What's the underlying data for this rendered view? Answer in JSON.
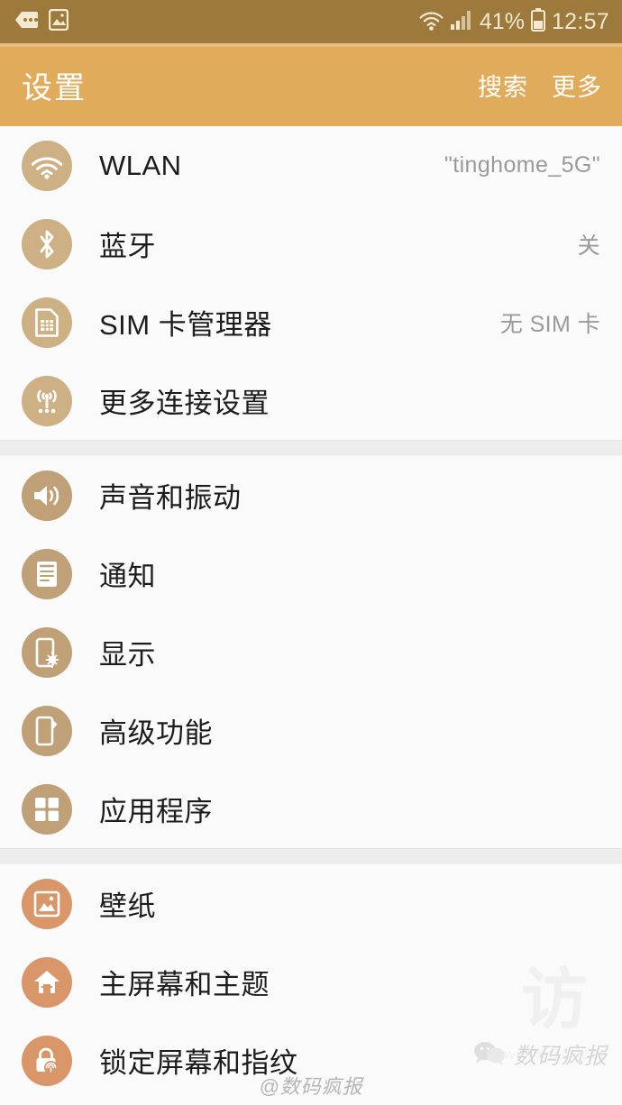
{
  "status_bar": {
    "background": "#9d7a3c",
    "foreground": "#f3e8d2",
    "notification_icons": [
      "message-bubble-icon",
      "gallery-image-icon"
    ],
    "wifi_icon": "wifi-icon",
    "signal_icon": "cellular-signal-icon",
    "battery_percent": "41%",
    "battery_icon": "battery-icon",
    "time": "12:57"
  },
  "app_bar": {
    "background": "#e0ab5b",
    "title": "设置",
    "actions": [
      {
        "label": "搜索",
        "name": "search"
      },
      {
        "label": "更多",
        "name": "more"
      }
    ]
  },
  "groups": [
    {
      "icon_color": "#cdb083",
      "rows": [
        {
          "icon": "wifi-icon",
          "label": "WLAN",
          "value": "\"tinghome_5G\""
        },
        {
          "icon": "bluetooth-icon",
          "label": "蓝牙",
          "value": "关"
        },
        {
          "icon": "sim-card-icon",
          "label": "SIM 卡管理器",
          "value": "无 SIM 卡"
        },
        {
          "icon": "broadcast-antenna-icon",
          "label": "更多连接设置",
          "value": ""
        }
      ]
    },
    {
      "icon_color": "#bfa077",
      "rows": [
        {
          "icon": "speaker-volume-icon",
          "label": "声音和振动",
          "value": ""
        },
        {
          "icon": "notification-list-icon",
          "label": "通知",
          "value": ""
        },
        {
          "icon": "display-brightness-icon",
          "label": "显示",
          "value": ""
        },
        {
          "icon": "advanced-features-icon",
          "label": "高级功能",
          "value": ""
        },
        {
          "icon": "apps-grid-icon",
          "label": "应用程序",
          "value": ""
        }
      ]
    },
    {
      "icon_color": "#d99668",
      "rows": [
        {
          "icon": "wallpaper-image-icon",
          "label": "壁纸",
          "value": ""
        },
        {
          "icon": "home-screen-themes-icon",
          "label": "主屏幕和主题",
          "value": ""
        },
        {
          "icon": "lock-fingerprint-icon",
          "label": "锁定屏幕和指纹",
          "value": ""
        }
      ]
    }
  ],
  "watermarks": {
    "bottom": "@数码疯报",
    "side": "数码疯报",
    "side_icon": "wechat-bubble-icon",
    "ghost_text": "访",
    "ghost_sub": "www.QQ.cc"
  }
}
